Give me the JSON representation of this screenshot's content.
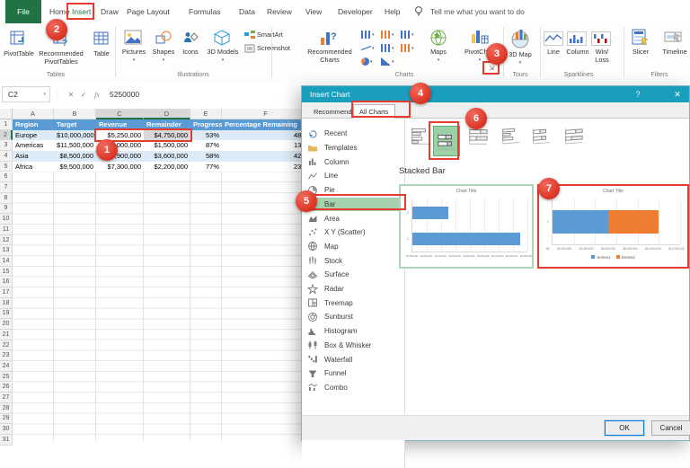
{
  "app": {
    "menu": {
      "file": "File",
      "items": [
        "Home",
        "Insert",
        "Draw",
        "Page Layout",
        "Formulas",
        "Data",
        "Review",
        "View",
        "Developer",
        "Help"
      ],
      "active_item": "Insert",
      "tell_me": "Tell me what you want to do"
    },
    "ribbon": {
      "tables": {
        "label": "Tables",
        "pivottable": "PivotTable",
        "recommended_pivottables": "Recommended PivotTables",
        "table": "Table"
      },
      "illustrations": {
        "label": "Illustrations",
        "pictures": "Pictures",
        "shapes": "Shapes",
        "icons": "Icons",
        "models": "3D Models",
        "smartart": "SmartArt",
        "screenshot": "Screenshot"
      },
      "charts": {
        "label": "Charts",
        "recommended": "Recommended Charts",
        "maps": "Maps",
        "pivotchart": "PivotChart"
      },
      "tours": {
        "label": "Tours",
        "map3d": "3D Map"
      },
      "sparklines": {
        "label": "Sparklines",
        "line": "Line",
        "column": "Column",
        "winloss": "Win/ Loss"
      },
      "filters": {
        "label": "Filters",
        "slicer": "Slicer",
        "timeline": "Timeline"
      }
    }
  },
  "formula_bar": {
    "name_box": "C2",
    "value": "5250000"
  },
  "sheet": {
    "column_letters": [
      "A",
      "B",
      "C",
      "D",
      "E",
      "F"
    ],
    "visible_row_count": 31,
    "selected_columns": [
      "C",
      "D"
    ],
    "selected_row": "2",
    "table": {
      "headers": [
        "Region",
        "Target",
        "Revenue",
        "Remainder",
        "Progress",
        "Percentage Remaining"
      ],
      "rows": [
        [
          "Europe",
          "$10,000,000",
          "$5,250,000",
          "$4,750,000",
          "53%",
          "48%"
        ],
        [
          "Americas",
          "$11,500,000",
          "$10,000,000",
          "$1,500,000",
          "87%",
          "13%"
        ],
        [
          "Asia",
          "$8,500,000",
          "$4,900,000",
          "$3,600,000",
          "58%",
          "42%"
        ],
        [
          "Africa",
          "$9,500,000",
          "$7,300,000",
          "$2,200,000",
          "77%",
          "23%"
        ]
      ]
    }
  },
  "dialog": {
    "title": "Insert Chart",
    "help_icon": "?",
    "close_icon": "✕",
    "tabs": [
      "Recommended Charts",
      "All Charts"
    ],
    "active_tab": "All Charts",
    "chart_types": [
      {
        "label": "Recent",
        "icon": "recent"
      },
      {
        "label": "Templates",
        "icon": "templates"
      },
      {
        "label": "Column",
        "icon": "column"
      },
      {
        "label": "Line",
        "icon": "line"
      },
      {
        "label": "Pie",
        "icon": "pie"
      },
      {
        "label": "Bar",
        "icon": "bar"
      },
      {
        "label": "Area",
        "icon": "area"
      },
      {
        "label": "X Y (Scatter)",
        "icon": "scatter"
      },
      {
        "label": "Map",
        "icon": "map"
      },
      {
        "label": "Stock",
        "icon": "stock"
      },
      {
        "label": "Surface",
        "icon": "surface"
      },
      {
        "label": "Radar",
        "icon": "radar"
      },
      {
        "label": "Treemap",
        "icon": "treemap"
      },
      {
        "label": "Sunburst",
        "icon": "sunburst"
      },
      {
        "label": "Histogram",
        "icon": "histogram"
      },
      {
        "label": "Box & Whisker",
        "icon": "boxwhisker"
      },
      {
        "label": "Waterfall",
        "icon": "waterfall"
      },
      {
        "label": "Funnel",
        "icon": "funnel"
      },
      {
        "label": "Combo",
        "icon": "combo"
      }
    ],
    "selected_chart_type": "Bar",
    "section_title": "Stacked Bar",
    "ok": "OK",
    "cancel": "Cancel"
  },
  "chart_data": [
    {
      "type": "bar",
      "title": "Chart Title",
      "categories": [
        "2",
        "1"
      ],
      "values": [
        4750000,
        5250000
      ],
      "xlim": [
        4500000,
        5300000
      ],
      "x_ticks": [
        "$4,500,000",
        "$4,600,000",
        "$4,700,000",
        "$4,800,000",
        "$4,900,000",
        "$5,000,000",
        "$5,100,000",
        "$5,200,000",
        "$5,300,000"
      ],
      "bar_color": "#5B9BD5",
      "grid": true,
      "selected_preview": true
    },
    {
      "type": "stacked-bar",
      "title": "Chart Title",
      "categories": [
        "1"
      ],
      "series": [
        {
          "name": "Series1",
          "values": [
            5250000
          ],
          "color": "#5B9BD5"
        },
        {
          "name": "Series2",
          "values": [
            4750000
          ],
          "color": "#ED7D31"
        }
      ],
      "xlim": [
        0,
        12000000
      ],
      "x_ticks": [
        "$0",
        "$2,000,000",
        "$4,000,000",
        "$6,000,000",
        "$8,000,000",
        "$10,000,000",
        "$12,000,000"
      ],
      "grid": true,
      "legend_position": "bottom"
    }
  ],
  "annotations": {
    "steps": [
      "1",
      "2",
      "3",
      "4",
      "5",
      "6",
      "7"
    ]
  },
  "colors": {
    "excel_green": "#217346",
    "dialog_titlebar": "#199EBE",
    "table_header": "#5B9BD5",
    "band_row": "#DDEBF7",
    "series1_blue": "#5B9BD5",
    "series2_orange": "#ED7D31",
    "annotation_red": "#E23D2E",
    "selection_green": "#A5D2AC"
  }
}
